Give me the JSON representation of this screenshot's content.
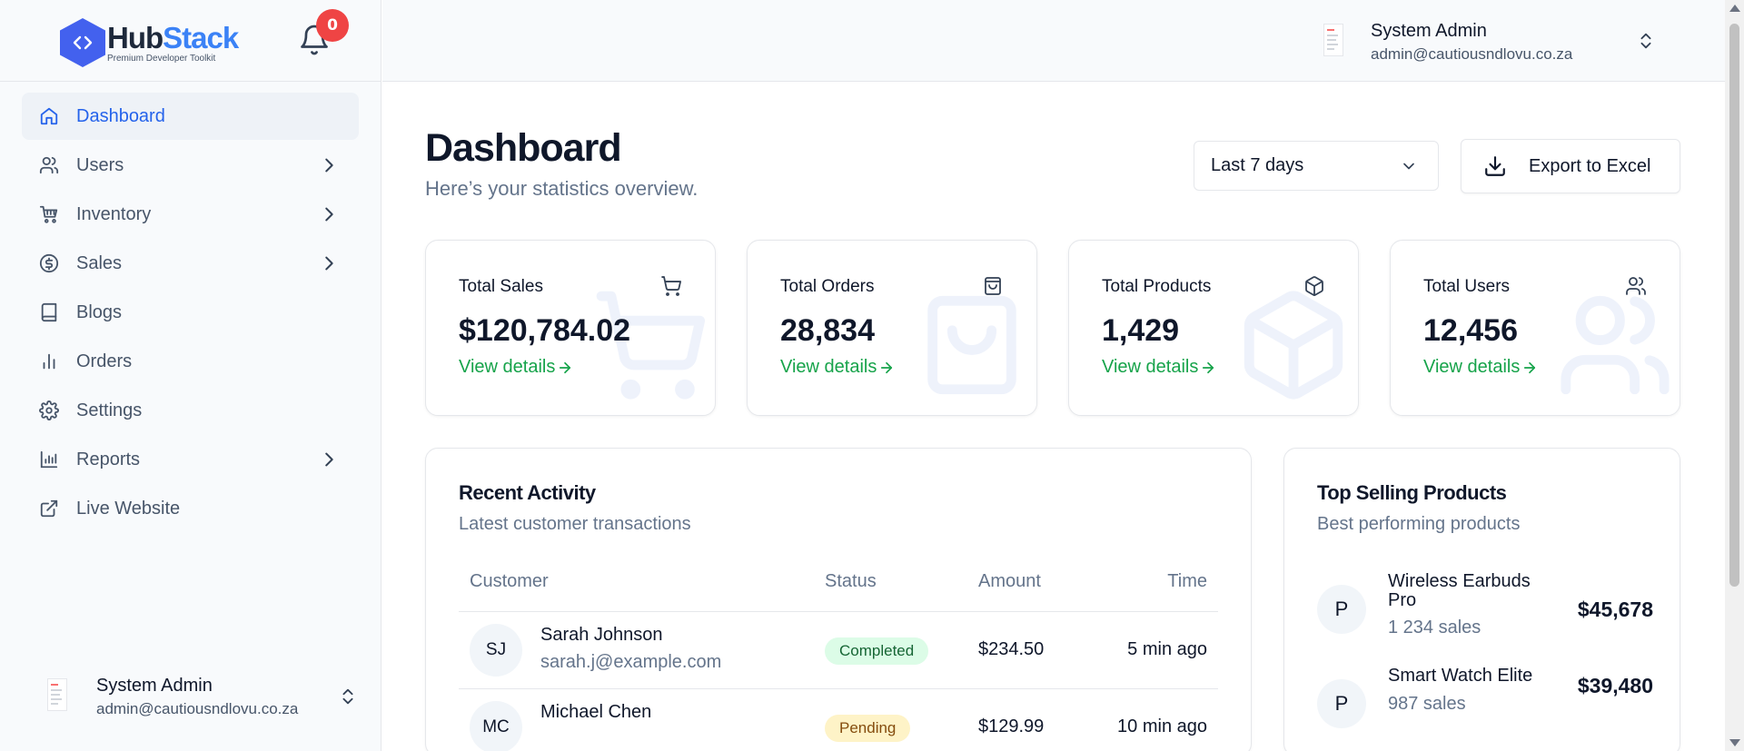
{
  "brand": {
    "name_part1": "Hub",
    "name_part2": "Stack",
    "tagline": "Premium Developer Toolkit",
    "accent": "#3b82f6",
    "logo_color": "#4361ee"
  },
  "notifications": {
    "count": "0",
    "badge_color": "#ef4444"
  },
  "sidebar": {
    "items": [
      {
        "label": "Dashboard",
        "icon": "home-icon",
        "active": true,
        "has_submenu": false
      },
      {
        "label": "Users",
        "icon": "users-icon",
        "has_submenu": true
      },
      {
        "label": "Inventory",
        "icon": "cart-stack-icon",
        "has_submenu": true
      },
      {
        "label": "Sales",
        "icon": "dollar-circle-icon",
        "has_submenu": true
      },
      {
        "label": "Blogs",
        "icon": "book-icon",
        "has_submenu": false
      },
      {
        "label": "Orders",
        "icon": "bar-chart-icon",
        "has_submenu": false
      },
      {
        "label": "Settings",
        "icon": "gear-icon",
        "has_submenu": false
      },
      {
        "label": "Reports",
        "icon": "chart-icon",
        "has_submenu": true
      },
      {
        "label": "Live Website",
        "icon": "external-link-icon",
        "has_submenu": false
      }
    ]
  },
  "user": {
    "name": "System Admin",
    "email": "admin@cautiousndlovu.co.za"
  },
  "page": {
    "title": "Dashboard",
    "subtitle": "Here’s your statistics overview.",
    "range_selected": "Last 7 days",
    "export_label": "Export to Excel"
  },
  "stats": [
    {
      "title": "Total Sales",
      "value": "$120,784.02",
      "link": "View details",
      "icon": "cart-icon"
    },
    {
      "title": "Total Orders",
      "value": "28,834",
      "link": "View details",
      "icon": "shopping-bag-icon"
    },
    {
      "title": "Total Products",
      "value": "1,429",
      "link": "View details",
      "icon": "box-icon"
    },
    {
      "title": "Total Users",
      "value": "12,456",
      "link": "View details",
      "icon": "users-icon"
    }
  ],
  "recent_activity": {
    "title": "Recent Activity",
    "subtitle": "Latest customer transactions",
    "columns": {
      "customer": "Customer",
      "status": "Status",
      "amount": "Amount",
      "time": "Time"
    },
    "rows": [
      {
        "initials": "SJ",
        "name": "Sarah Johnson",
        "email": "sarah.j@example.com",
        "status": "Completed",
        "amount": "$234.50",
        "time": "5 min ago"
      },
      {
        "initials": "MC",
        "name": "Michael Chen",
        "email": "",
        "status": "Pending",
        "amount": "$129.99",
        "time": "10 min ago"
      }
    ]
  },
  "top_selling": {
    "title": "Top Selling Products",
    "subtitle": "Best performing products",
    "items": [
      {
        "avatar": "P",
        "name": "Wireless Earbuds Pro",
        "sales": "1 234 sales",
        "amount": "$45,678"
      },
      {
        "avatar": "P",
        "name": "Smart Watch Elite",
        "sales": "987 sales",
        "amount": "$39,480"
      }
    ]
  },
  "colors": {
    "success": "#16a34a",
    "active_nav": "#2563eb",
    "muted": "#64748b"
  }
}
